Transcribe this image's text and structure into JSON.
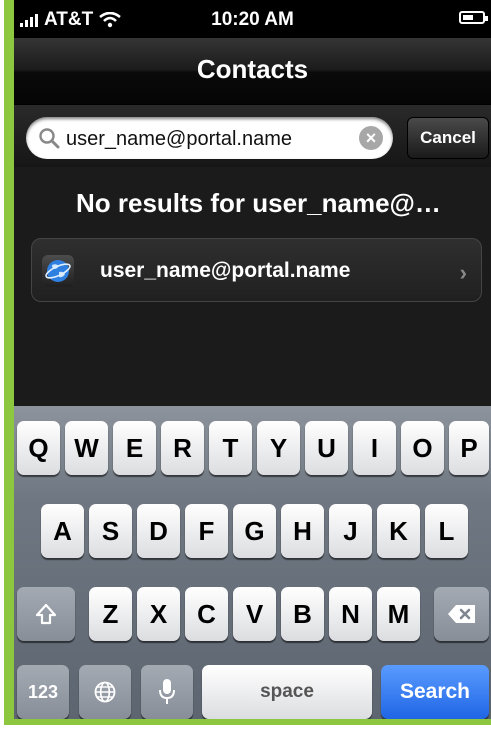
{
  "status_bar": {
    "carrier": "AT&T",
    "time": "10:20 AM"
  },
  "nav": {
    "title": "Contacts"
  },
  "search": {
    "query": "user_name@portal.name",
    "cancel_label": "Cancel"
  },
  "results": {
    "no_results_text": "No results for user_name@…",
    "items": [
      {
        "label": "user_name@portal.name",
        "icon": "globe-icon"
      }
    ]
  },
  "keyboard": {
    "row1": [
      "Q",
      "W",
      "E",
      "R",
      "T",
      "Y",
      "U",
      "I",
      "O",
      "P"
    ],
    "row2": [
      "A",
      "S",
      "D",
      "F",
      "G",
      "H",
      "J",
      "K",
      "L"
    ],
    "row3": [
      "Z",
      "X",
      "C",
      "V",
      "B",
      "N",
      "M"
    ],
    "numbers_label": "123",
    "space_label": "space",
    "search_label": "Search"
  },
  "colors": {
    "frame_accent": "#8dc63f",
    "search_key": "#1f66e5"
  }
}
